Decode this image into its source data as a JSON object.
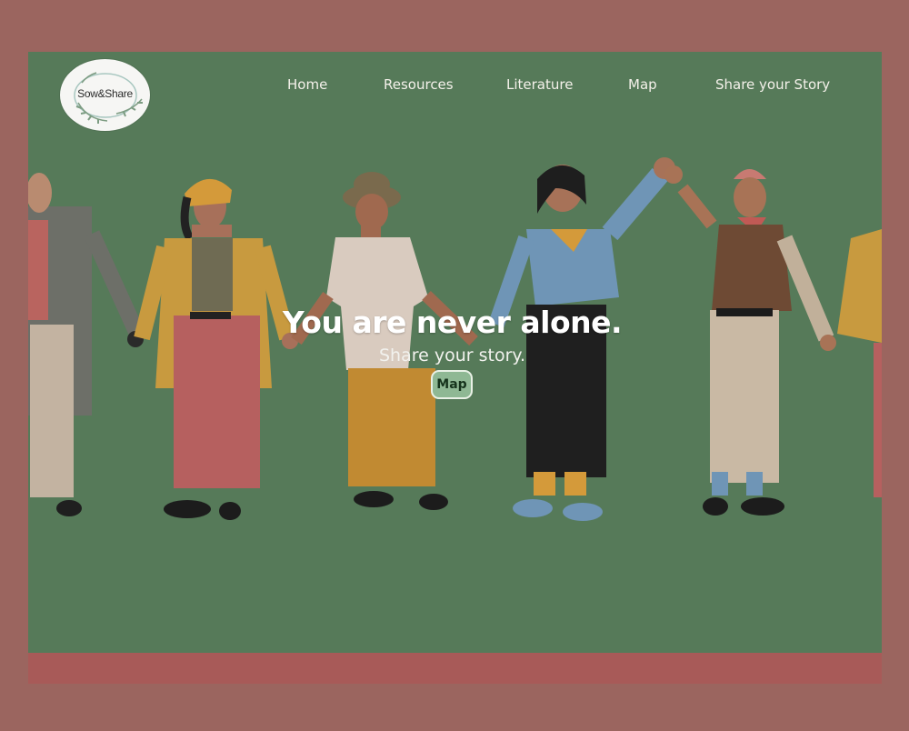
{
  "logo": {
    "text": "Sow&Share",
    "icon": "laurel-wreath-icon"
  },
  "nav": {
    "items": [
      {
        "label": "Home"
      },
      {
        "label": "Resources"
      },
      {
        "label": "Literature"
      },
      {
        "label": "Map"
      },
      {
        "label": "Share your Story"
      }
    ]
  },
  "hero": {
    "headline": "You are never alone.",
    "subhead": "Share your story.",
    "button_label": "Map"
  },
  "colors": {
    "page_background": "#9b655f",
    "hero_background": "#567a59",
    "footer_band": "#a85a58",
    "button_background": "#8fb894"
  }
}
